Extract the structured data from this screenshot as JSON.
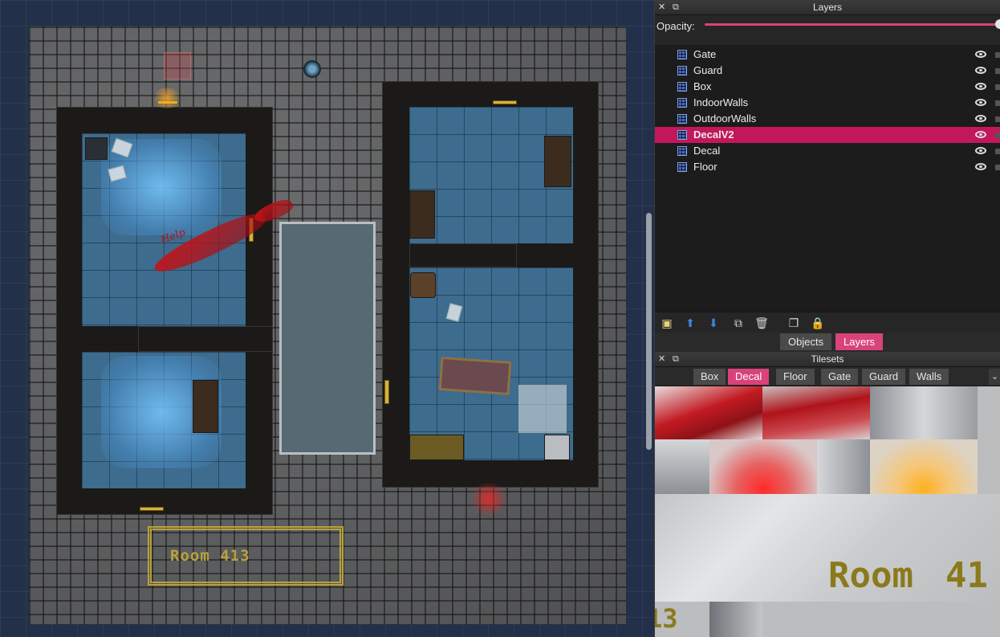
{
  "map": {
    "room_sign": "Room 413",
    "graffiti": "Help"
  },
  "layers_panel": {
    "title": "Layers",
    "close_icon": "close-icon",
    "float_icon": "float-icon",
    "opacity_label": "Opacity:",
    "opacity_level": 1.0,
    "layers": [
      {
        "name": "Gate",
        "selected": false
      },
      {
        "name": "Guard",
        "selected": false
      },
      {
        "name": "Box",
        "selected": false
      },
      {
        "name": "IndoorWalls",
        "selected": false
      },
      {
        "name": "OutdoorWalls",
        "selected": false
      },
      {
        "name": "DecalV2",
        "selected": true
      },
      {
        "name": "Decal",
        "selected": false
      },
      {
        "name": "Floor",
        "selected": false
      }
    ],
    "toolbar_icons": [
      "new-layer-icon",
      "move-up-icon",
      "move-down-icon",
      "duplicate-icon",
      "delete-icon",
      "toggle-other-layers-icon",
      "lock-icon"
    ],
    "tabs": [
      {
        "label": "Objects",
        "active": false
      },
      {
        "label": "Layers",
        "active": true
      }
    ]
  },
  "tilesets_panel": {
    "title": "Tilesets",
    "tabs": [
      {
        "label": "Box",
        "active": false
      },
      {
        "label": "Decal",
        "active": true
      },
      {
        "label": "Floor",
        "active": false
      },
      {
        "label": "Gate",
        "active": false
      },
      {
        "label": "Guard",
        "active": false
      },
      {
        "label": "Walls",
        "active": false
      }
    ],
    "tile_room_text": "Room",
    "tile_number_text": "41",
    "tile_fragment_text": "13"
  },
  "colors": {
    "accent": "#d9437a",
    "selected_row": "#c2185b",
    "panel_bg": "#1f1f1f",
    "canvas_bg": "#23304a"
  }
}
